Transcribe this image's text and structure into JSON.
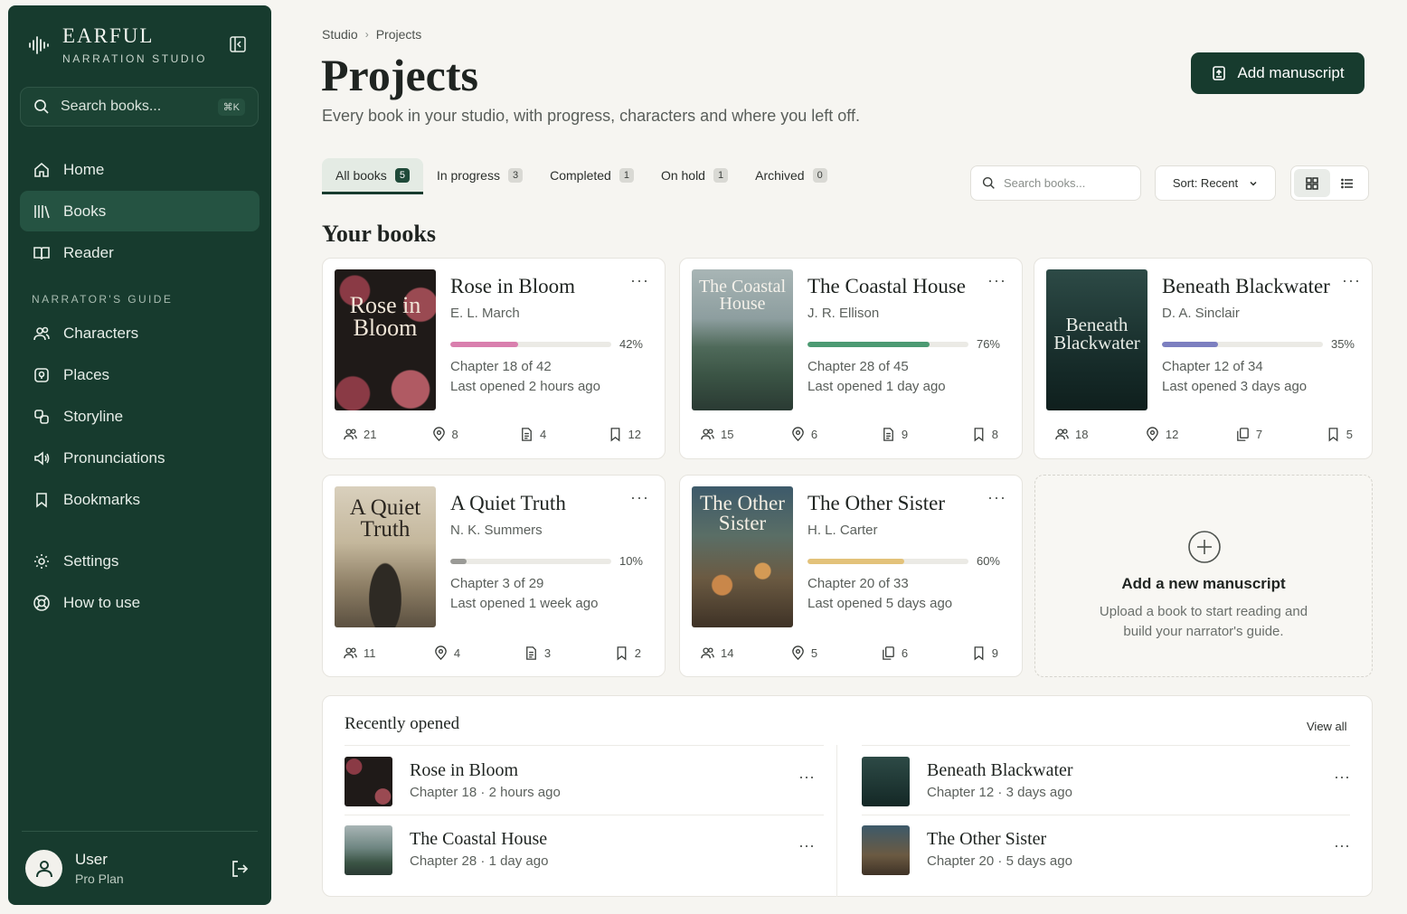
{
  "brand": {
    "name": "EARFUL",
    "subtitle": "NARRATION STUDIO"
  },
  "sidebar": {
    "search_placeholder": "Search books...",
    "search_shortcut": "⌘K",
    "nav_main": [
      {
        "label": "Home",
        "icon": "home-icon"
      },
      {
        "label": "Books",
        "icon": "books-icon",
        "active": true
      },
      {
        "label": "Reader",
        "icon": "open-book-icon"
      }
    ],
    "guide_heading": "NARRATOR'S GUIDE",
    "nav_guide": [
      {
        "label": "Characters",
        "icon": "users-icon"
      },
      {
        "label": "Places",
        "icon": "map-icon"
      },
      {
        "label": "Storyline",
        "icon": "storyline-icon"
      },
      {
        "label": "Pronunciations",
        "icon": "speaker-icon"
      },
      {
        "label": "Bookmarks",
        "icon": "bookmark-icon"
      }
    ],
    "nav_bottom": [
      {
        "label": "Settings",
        "icon": "gear-icon"
      },
      {
        "label": "How to use",
        "icon": "help-icon"
      }
    ],
    "user": {
      "name": "User",
      "plan": "Pro Plan"
    }
  },
  "header": {
    "breadcrumb": [
      "Studio",
      "Projects"
    ],
    "title": "Projects",
    "subtitle": "Every book in your studio, with progress, characters and where you left off.",
    "add_button": "Add manuscript"
  },
  "tabs": [
    {
      "label": "All books",
      "count": "5",
      "active": true
    },
    {
      "label": "In progress",
      "count": "3"
    },
    {
      "label": "Completed",
      "count": "1"
    },
    {
      "label": "On hold",
      "count": "1"
    },
    {
      "label": "Archived",
      "count": "0"
    }
  ],
  "toolbar": {
    "search_placeholder": "Search books...",
    "sort_label": "Sort: Recent"
  },
  "books_section_title": "Your books",
  "books": [
    {
      "title": "Rose in Bloom",
      "author": "E. L. March",
      "progress": 42,
      "progress_label": "42%",
      "bar_color": "#d97fae",
      "chapter": "Chapter 18 of 42",
      "last_opened": "Last opened 2 hours ago",
      "stats": {
        "characters": "21",
        "places": "8",
        "notes": "4",
        "bookmarks": "12"
      },
      "cover_text": "Rose in Bloom"
    },
    {
      "title": "The Coastal House",
      "author": "J. R. Ellison",
      "progress": 76,
      "progress_label": "76%",
      "bar_color": "#4c9a72",
      "chapter": "Chapter 28 of 45",
      "last_opened": "Last opened 1 day ago",
      "stats": {
        "characters": "15",
        "places": "6",
        "notes": "9",
        "bookmarks": "8"
      },
      "cover_text": "The Coastal House"
    },
    {
      "title": "Beneath Blackwater",
      "author": "D. A. Sinclair",
      "progress": 35,
      "progress_label": "35%",
      "bar_color": "#7c7fc0",
      "chapter": "Chapter 12 of 34",
      "last_opened": "Last opened 3 days ago",
      "stats": {
        "characters": "18",
        "places": "12",
        "notes": "7",
        "bookmarks": "5"
      },
      "cover_text": "Beneath Blackwater"
    },
    {
      "title": "A Quiet Truth",
      "author": "N. K. Summers",
      "progress": 10,
      "progress_label": "10%",
      "bar_color": "#9a9a96",
      "chapter": "Chapter 3 of 29",
      "last_opened": "Last opened 1 week ago",
      "stats": {
        "characters": "11",
        "places": "4",
        "notes": "3",
        "bookmarks": "2"
      },
      "cover_text": "A Quiet Truth"
    },
    {
      "title": "The Other Sister",
      "author": "H. L. Carter",
      "progress": 60,
      "progress_label": "60%",
      "bar_color": "#e3c27a",
      "chapter": "Chapter 20 of 33",
      "last_opened": "Last opened 5 days ago",
      "stats": {
        "characters": "14",
        "places": "5",
        "notes": "6",
        "bookmarks": "9"
      },
      "cover_text": "The Other Sister"
    }
  ],
  "add_card": {
    "title": "Add a new manuscript",
    "description": "Upload a book to start reading and build your narrator's guide."
  },
  "recent": {
    "title": "Recently opened",
    "view_all": "View all",
    "items": [
      {
        "title": "Rose in Bloom",
        "chapter": "Chapter 18",
        "time": "2 hours ago"
      },
      {
        "title": "Beneath Blackwater",
        "chapter": "Chapter 12",
        "time": "3 days ago"
      },
      {
        "title": "The Coastal House",
        "chapter": "Chapter 28",
        "time": "1 day ago"
      },
      {
        "title": "The Other Sister",
        "chapter": "Chapter 20",
        "time": "5 days ago"
      }
    ]
  },
  "colors": {
    "sidebar": "#173b2e",
    "accent": "#173b2e",
    "background": "#f6f5f1"
  }
}
